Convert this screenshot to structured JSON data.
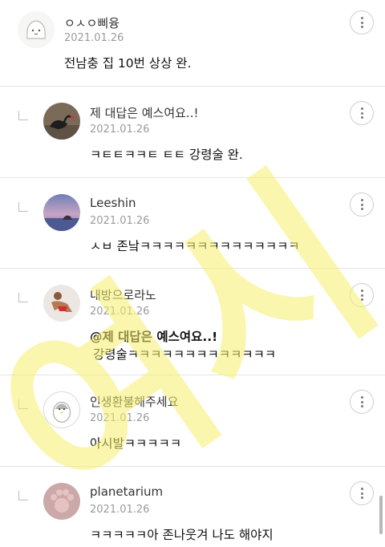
{
  "comments": [
    {
      "name": "ㅇㅅㅇ삐융",
      "date": "2021.01.26",
      "body": "전남충 집 10번 상상 완.",
      "avatar_icon": "ghost-character-avatar"
    },
    {
      "name": "제 대답은 예스여요..!",
      "date": "2021.01.26",
      "body": "ㅋㅌㅌㅋㅋㅌ ㅌㅌ 강령술 완.",
      "avatar_icon": "black-swan-photo-avatar"
    },
    {
      "name": "Leeshin",
      "date": "2021.01.26",
      "body": "ㅅㅂ 존낰ㅋㅋㅋㅋㅋㅋㅋㅋㅋㅋㅋㅋㅋㅋ",
      "avatar_icon": "sunset-lake-avatar"
    },
    {
      "name": "내방으로라노",
      "date": "2021.01.26",
      "body": "@제 대답은 예스여요..!",
      "body2": "강령술ㅋㅋㅋㅋㅋㅋㅋㅋㅋㅋㅋㅋㅋ",
      "avatar_icon": "person-in-red-avatar"
    },
    {
      "name": "인생환불해주세요",
      "date": "2021.01.26",
      "body": "아시발ㅋㅋㅋㅋㅋ",
      "avatar_icon": "penguin-character-avatar"
    },
    {
      "name": "planetarium",
      "date": "2021.01.26",
      "body": "ㅋㅋㅋㅋㅋ아 존나웃겨 나도 해야지",
      "avatar_icon": "pink-paw-avatar"
    }
  ],
  "watermark": {
    "text": "여시",
    "color": "#f5ef6a"
  }
}
